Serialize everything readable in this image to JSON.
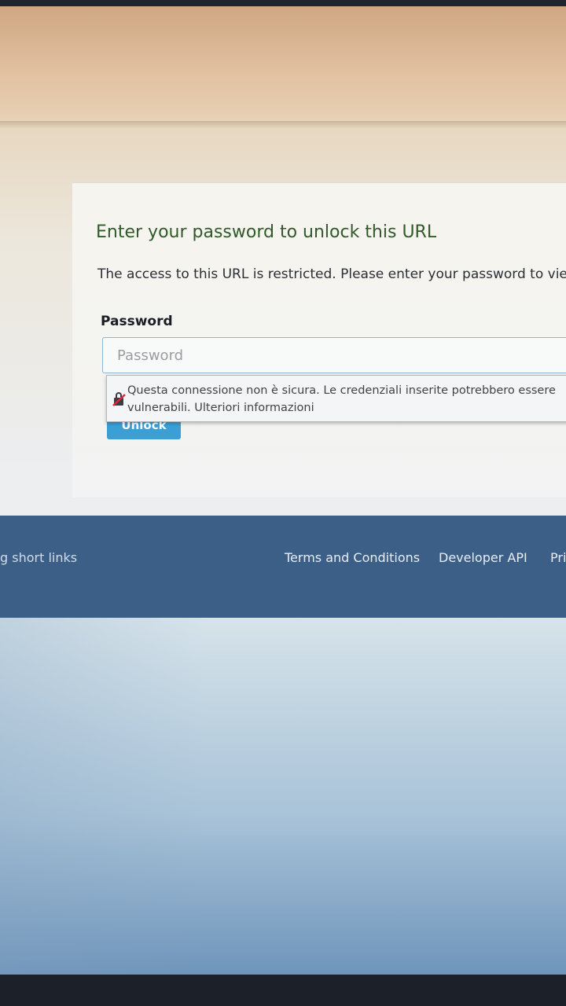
{
  "card": {
    "title": "Enter your password to unlock this URL",
    "description": "The access to this URL is restricted. Please enter your password to view",
    "password_label": "Password",
    "password_placeholder": "Password",
    "password_value": "",
    "unlock_button_label": "Unlock"
  },
  "security_warning": {
    "icon": "insecure-lock-icon",
    "text": "Questa connessione non è sicura. Le credenziali inserite potrebbero essere vulnerabili. Ulteriori informazioni"
  },
  "footer": {
    "tagline_fragment": "g short links",
    "links": [
      {
        "label": "Terms and Conditions"
      },
      {
        "label": "Developer API"
      },
      {
        "label": "Pri"
      }
    ]
  },
  "colors": {
    "title_green": "#2f5a2a",
    "button_blue": "#3b9fd6",
    "footer_blue": "#3c5f88"
  }
}
